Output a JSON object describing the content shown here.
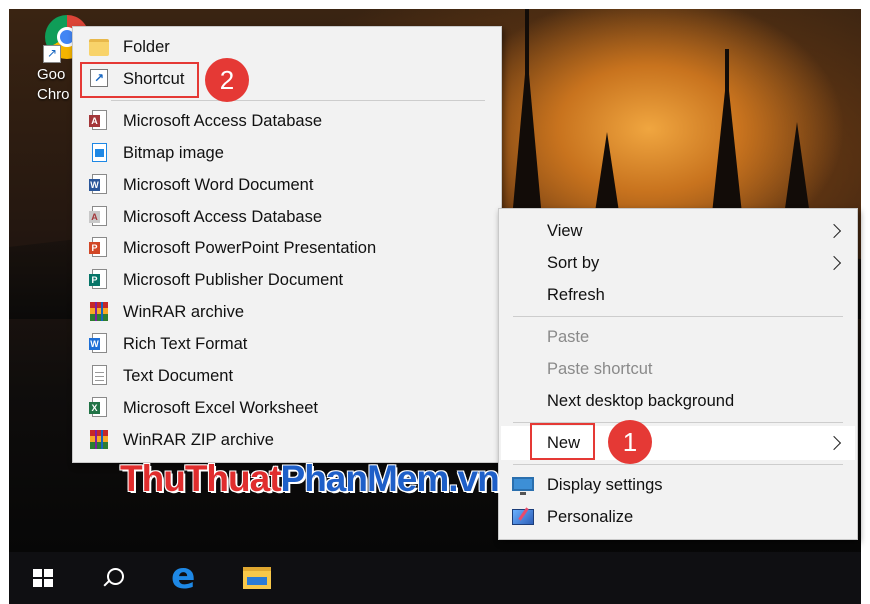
{
  "desktop": {
    "icon_label_line1": "Goo",
    "icon_label_line2": "Chro"
  },
  "new_submenu": {
    "items": [
      {
        "label": "Folder",
        "icon": "folder-icon"
      },
      {
        "label": "Shortcut",
        "icon": "shortcut-icon"
      },
      {
        "label": "Microsoft Access Database",
        "icon": "access-icon"
      },
      {
        "label": "Bitmap image",
        "icon": "bitmap-icon"
      },
      {
        "label": "Microsoft Word Document",
        "icon": "word-icon"
      },
      {
        "label": "Microsoft Access Database",
        "icon": "access-icon"
      },
      {
        "label": "Microsoft PowerPoint Presentation",
        "icon": "powerpoint-icon"
      },
      {
        "label": "Microsoft Publisher Document",
        "icon": "publisher-icon"
      },
      {
        "label": "WinRAR archive",
        "icon": "winrar-icon"
      },
      {
        "label": "Rich Text Format",
        "icon": "wordpad-icon"
      },
      {
        "label": "Text Document",
        "icon": "text-document-icon"
      },
      {
        "label": "Microsoft Excel Worksheet",
        "icon": "excel-icon"
      },
      {
        "label": "WinRAR ZIP archive",
        "icon": "winrar-icon"
      }
    ]
  },
  "context_menu": {
    "items": [
      {
        "label": "View",
        "has_submenu": true,
        "disabled": false
      },
      {
        "label": "Sort by",
        "has_submenu": true,
        "disabled": false
      },
      {
        "label": "Refresh",
        "has_submenu": false,
        "disabled": false
      },
      {
        "label": "Paste",
        "has_submenu": false,
        "disabled": true
      },
      {
        "label": "Paste shortcut",
        "has_submenu": false,
        "disabled": true
      },
      {
        "label": "Next desktop background",
        "has_submenu": false,
        "disabled": false
      },
      {
        "label": "New",
        "has_submenu": true,
        "disabled": false,
        "highlighted": true
      },
      {
        "label": "Display settings",
        "has_submenu": false,
        "disabled": false,
        "icon": "display-icon"
      },
      {
        "label": "Personalize",
        "has_submenu": false,
        "disabled": false,
        "icon": "personalize-icon"
      }
    ]
  },
  "annotations": {
    "step1": "1",
    "step2": "2",
    "color": "#e53935"
  },
  "watermark": {
    "part1": "Thu",
    "part2": "Thuat",
    "part3": "PhanMem",
    "part4": ".vn"
  },
  "taskbar": {
    "items": [
      "windows-start-icon",
      "search-icon",
      "edge-icon",
      "file-explorer-icon"
    ],
    "background": "#0f0f12"
  }
}
